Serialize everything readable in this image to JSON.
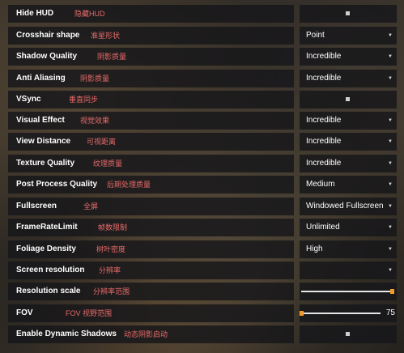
{
  "settings": {
    "hide_hud": {
      "label": "Hide HUD",
      "label_cn": "隐藏HUD",
      "type": "checkbox"
    },
    "crosshair_shape": {
      "label": "Crosshair shape",
      "label_cn": "准星形状",
      "value": "Point"
    },
    "shadow_quality": {
      "label": "Shadow Quality",
      "label_cn": "阴影质量",
      "value": "Incredible"
    },
    "anti_aliasing": {
      "label": "Anti Aliasing",
      "label_cn": "阴影质量",
      "value": "Incredible"
    },
    "vsync": {
      "label": "VSync",
      "label_cn": "垂直同步",
      "type": "checkbox"
    },
    "visual_effect": {
      "label": "Visual Effect",
      "label_cn": "视觉效果",
      "value": "Incredible"
    },
    "view_distance": {
      "label": "View Distance",
      "label_cn": "可视距离",
      "value": "Incredible"
    },
    "texture_quality": {
      "label": "Texture Quality",
      "label_cn": "纹理质量",
      "value": "Incredible"
    },
    "post_process_quality": {
      "label": "Post Process Quality",
      "label_cn": "后期处理质量",
      "value": "Medium"
    },
    "fullscreen": {
      "label": "Fullscreen",
      "label_cn": "全屏",
      "value": "Windowed Fullscreen"
    },
    "framerate_limit": {
      "label": "FrameRateLimit",
      "label_cn": "帧数限制",
      "value": "Unlimited"
    },
    "foliage_density": {
      "label": "Foliage Density",
      "label_cn": "树叶密度",
      "value": "High"
    },
    "screen_resolution": {
      "label": "Screen resolution",
      "label_cn": "分辨率",
      "value": ""
    },
    "resolution_scale": {
      "label": "Resolution scale",
      "label_cn": "分辨率范围",
      "fraction": 1.0
    },
    "fov": {
      "label": "FOV",
      "label_cn": "FOV 视野范围",
      "value": "75",
      "fraction": 0.0
    },
    "enable_dynamic_shadows": {
      "label": "Enable Dynamic Shadows",
      "label_cn": "动态阴影启动",
      "type": "checkbox"
    }
  },
  "icons": {
    "dropdown": "chevron-down-icon",
    "checkbox": "checkbox-icon"
  },
  "colors": {
    "label_cn": "#e96b6b",
    "slider_handle": "#f39b2a",
    "panel": "#16161a"
  }
}
